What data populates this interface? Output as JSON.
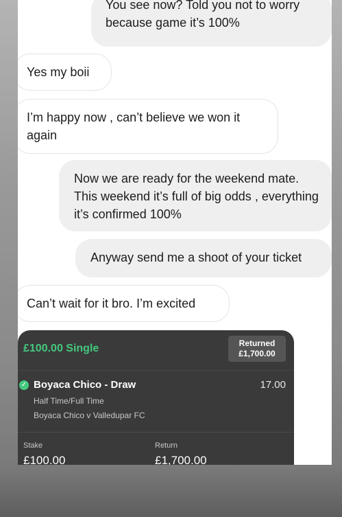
{
  "messages": [
    {
      "direction": "outgoing",
      "text": "You see now? Told you not to worry because game it’s 100%"
    },
    {
      "direction": "incoming",
      "text": "Yes my boii"
    },
    {
      "direction": "incoming",
      "text": "I’m happy now , can’t believe we won it again"
    },
    {
      "direction": "outgoing",
      "text": "Now we are ready for the weekend mate. This weekend it’s full of big odds , everything it’s confirmed 100%"
    },
    {
      "direction": "outgoing",
      "text": "Anyway send me a shoot of your ticket"
    },
    {
      "direction": "incoming",
      "text": "Can’t wait for it bro. I’m excited"
    }
  ],
  "bet_ticket": {
    "title": "£100.00 Single",
    "returned_label": "Returned",
    "returned_value": "£1,700.00",
    "selection": "Boyaca Chico - Draw",
    "odds": "17.00",
    "market": "Half Time/Full Time",
    "event": "Boyaca Chico v Valledupar FC",
    "stake_label": "Stake",
    "stake_value": "£100.00",
    "return_label": "Return",
    "return_value": "£1,700.00",
    "status_icon": "check-circle-icon",
    "accent_color": "#44c97f"
  }
}
